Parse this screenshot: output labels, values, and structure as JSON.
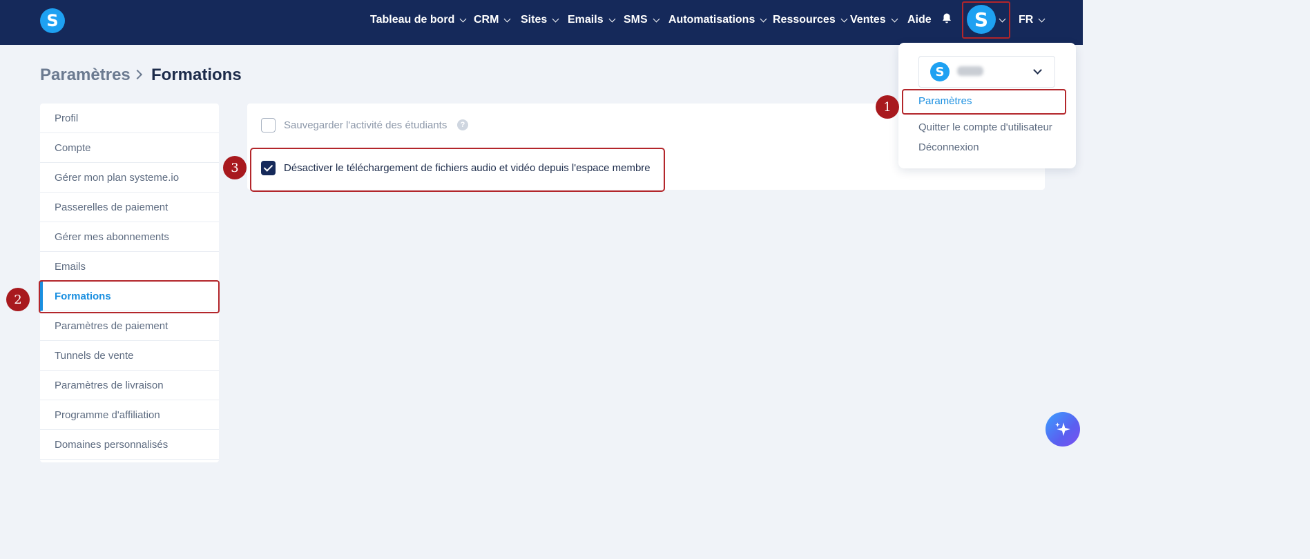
{
  "brand": {
    "logo_letter": "S"
  },
  "nav": {
    "items": [
      {
        "label": "Tableau de bord",
        "has_menu": true
      },
      {
        "label": "CRM",
        "has_menu": true
      },
      {
        "label": "Sites",
        "has_menu": true
      },
      {
        "label": "Emails",
        "has_menu": true
      },
      {
        "label": "SMS",
        "has_menu": true
      },
      {
        "label": "Automatisations",
        "has_menu": true
      },
      {
        "label": "Ressources",
        "has_menu": true
      },
      {
        "label": "Ventes",
        "has_menu": true
      },
      {
        "label": "Aide",
        "has_menu": false
      }
    ],
    "avatar_letter": "S",
    "language": "FR"
  },
  "breadcrumb": {
    "parent": "Paramètres",
    "current": "Formations"
  },
  "sidebar": {
    "items": [
      {
        "label": "Profil"
      },
      {
        "label": "Compte"
      },
      {
        "label": "Gérer mon plan systeme.io"
      },
      {
        "label": "Passerelles de paiement"
      },
      {
        "label": "Gérer mes abonnements"
      },
      {
        "label": "Emails"
      },
      {
        "label": "Formations",
        "active": true
      },
      {
        "label": "Paramètres de paiement"
      },
      {
        "label": "Tunnels de vente"
      },
      {
        "label": "Paramètres de livraison"
      },
      {
        "label": "Programme d'affiliation"
      },
      {
        "label": "Domaines personnalisés"
      }
    ]
  },
  "settings": {
    "option1": {
      "label": "Sauvegarder l'activité des étudiants",
      "checked": false,
      "help": "?"
    },
    "option2": {
      "label": "Désactiver le téléchargement de fichiers audio et vidéo depuis l'espace membre",
      "checked": true
    }
  },
  "user_menu": {
    "account_logo_letter": "S",
    "items": [
      {
        "label": "Paramètres"
      },
      {
        "label": "Quitter le compte d'utilisateur"
      },
      {
        "label": "Déconnexion"
      }
    ]
  },
  "markers": [
    "1",
    "2",
    "3"
  ],
  "colors": {
    "navbar": "#15295a",
    "accent": "#1a8fe0",
    "highlight": "#b3262b",
    "brand": "#1ea1f2"
  }
}
